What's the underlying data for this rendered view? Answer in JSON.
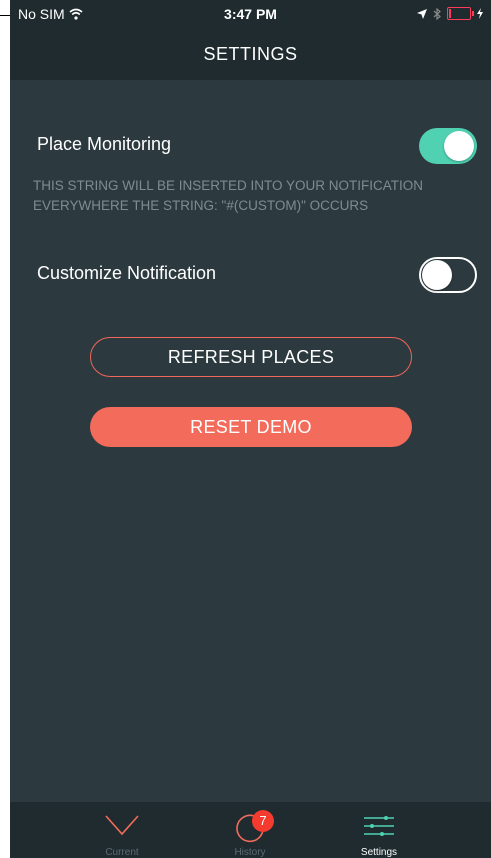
{
  "status_bar": {
    "carrier": "No SIM",
    "time": "3:47 PM"
  },
  "nav": {
    "title": "SETTINGS"
  },
  "settings": {
    "place_monitoring": {
      "label": "Place Monitoring",
      "enabled": true
    },
    "hint_text": "THIS STRING WILL BE INSERTED INTO YOUR NOTIFICATION EVERYWHERE THE STRING: \"#(CUSTOM)\" OCCURS",
    "customize_notification": {
      "label": "Customize Notification",
      "enabled": false
    }
  },
  "buttons": {
    "refresh_label": "REFRESH PLACES",
    "reset_label": "RESET DEMO"
  },
  "tabs": [
    {
      "label": "Current",
      "icon": "chevron-down-icon",
      "active": false
    },
    {
      "label": "History",
      "icon": "history-icon",
      "badge": "7",
      "active": false
    },
    {
      "label": "Settings",
      "icon": "sliders-icon",
      "active": true
    }
  ],
  "colors": {
    "background": "#2c3a3f",
    "bar": "#1f2b2f",
    "accent_teal": "#4fd1b2",
    "accent_coral": "#f26b5b",
    "badge_red": "#f33b2f"
  }
}
